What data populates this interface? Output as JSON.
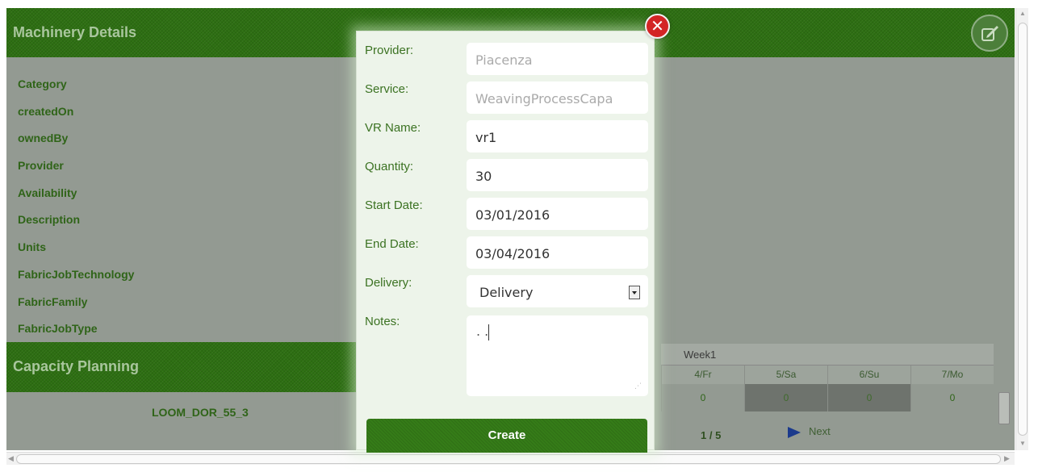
{
  "details": {
    "title": "Machinery Details",
    "properties": [
      "Category",
      "createdOn",
      "ownedBy",
      "Provider",
      "Availability",
      "Description",
      "Units",
      "FabricJobTechnology",
      "FabricFamily",
      "FabricJobType"
    ]
  },
  "capacity": {
    "title": "Capacity Planning",
    "machine": "LOOM_DOR_55_3",
    "week_label": "Week1",
    "days": [
      "4/Fr",
      "5/Sa",
      "6/Su",
      "7/Mo"
    ],
    "values": [
      "0",
      "0",
      "0",
      "0"
    ],
    "page": "1 / 5",
    "next_label": "Next"
  },
  "modal": {
    "close_icon": "close-icon",
    "fields": [
      {
        "label": "Provider:",
        "value": "Piacenza",
        "readonly": true
      },
      {
        "label": "Service:",
        "value": "WeavingProcessCapa",
        "readonly": true
      },
      {
        "label": "VR Name:",
        "value": "vr1",
        "readonly": false
      },
      {
        "label": "Quantity:",
        "value": "30",
        "readonly": false
      },
      {
        "label": "Start Date:",
        "value": "03/01/2016",
        "readonly": false
      },
      {
        "label": "End Date:",
        "value": "03/04/2016",
        "readonly": false
      }
    ],
    "delivery": {
      "label": "Delivery:",
      "selected": "Delivery"
    },
    "notes": {
      "label": "Notes:",
      "value": ". ."
    },
    "create_label": "Create"
  },
  "colors": {
    "accent_green": "#2d6f12",
    "label_green": "#3b7222",
    "close_red": "#d32525"
  }
}
